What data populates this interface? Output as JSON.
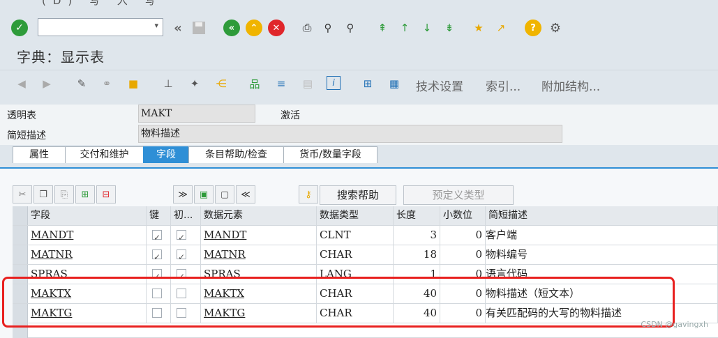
{
  "top_strip_text": "(D)   写 入   写",
  "command_field": {
    "value": "",
    "placeholder": ""
  },
  "page_title": "字典：显示表",
  "toolbar2": {
    "tech_settings": "技术设置",
    "index": "索引...",
    "append_structure": "附加结构..."
  },
  "header": {
    "transparent_table_label": "透明表",
    "table_name": "MAKT",
    "status": "激活",
    "short_desc_label": "简短描述",
    "short_desc_value": "物料描述"
  },
  "tabs": [
    {
      "label": "属性"
    },
    {
      "label": "交付和维护"
    },
    {
      "label": "字段"
    },
    {
      "label": "条目帮助/检查"
    },
    {
      "label": "货币/数量字段"
    }
  ],
  "active_tab": "字段",
  "table_toolbar": {
    "search_help": "搜索帮助",
    "predefined_type": "预定义类型"
  },
  "columns": [
    "字段",
    "键",
    "初...",
    "数据元素",
    "数据类型",
    "长度",
    "小数位",
    "简短描述"
  ],
  "rows": [
    {
      "field": "MANDT",
      "key": true,
      "init": true,
      "data_element": "MANDT",
      "data_type": "CLNT",
      "length": "3",
      "decimals": "0",
      "desc": "客户端"
    },
    {
      "field": "MATNR",
      "key": true,
      "init": true,
      "data_element": "MATNR",
      "data_type": "CHAR",
      "length": "18",
      "decimals": "0",
      "desc": "物料编号"
    },
    {
      "field": "SPRAS",
      "key": true,
      "init": true,
      "data_element": "SPRAS",
      "data_type": "LANG",
      "length": "1",
      "decimals": "0",
      "desc": "语言代码"
    },
    {
      "field": "MAKTX",
      "key": false,
      "init": false,
      "data_element": "MAKTX",
      "data_type": "CHAR",
      "length": "40",
      "decimals": "0",
      "desc": "物料描述（短文本）"
    },
    {
      "field": "MAKTG",
      "key": false,
      "init": false,
      "data_element": "MAKTG",
      "data_type": "CHAR",
      "length": "40",
      "decimals": "0",
      "desc": "有关匹配码的大写的物料描述"
    }
  ],
  "watermark": "CSDN @gavingxh",
  "colors": {
    "accent": "#2f8fd6",
    "highlight_box": "#e8201f",
    "ok_green": "#2e9b3a"
  }
}
